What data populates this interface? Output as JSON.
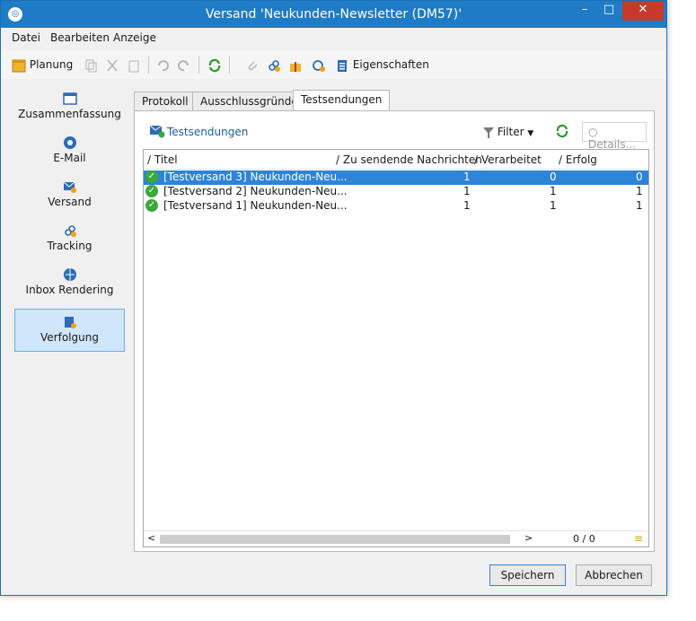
{
  "window": {
    "title": "Versand 'Neukunden-Newsletter (DM57)'",
    "minimize": "–",
    "maximize": "□",
    "close": "✕"
  },
  "menu": [
    "Datei",
    "Bearbeiten",
    "Anzeige"
  ],
  "toolbar": {
    "planung": "Planung",
    "eigenschaften": "Eigenschaften"
  },
  "nav": [
    {
      "label": "Zusammenfassung",
      "icon": "summary-icon"
    },
    {
      "label": "E-Mail",
      "icon": "email-icon"
    },
    {
      "label": "Versand",
      "icon": "delivery-icon"
    },
    {
      "label": "Tracking",
      "icon": "link-icon"
    },
    {
      "label": "Inbox Rendering",
      "icon": "globe-icon"
    },
    {
      "label": "Verfolgung",
      "icon": "tracking-icon",
      "selected": true
    }
  ],
  "tabs": [
    "Protokoll",
    "Ausschlussgründe",
    "Testsendungen"
  ],
  "subbar": {
    "title": "Testsendungen",
    "filter": "Filter",
    "details": "Details..."
  },
  "columns": [
    "Titel",
    "Zu sendende Nachrichten",
    "Verarbeitet",
    "Erfolg"
  ],
  "rows": [
    {
      "titel": "[Testversand 3] Neukunden-Neu...",
      "zu_senden": "1",
      "verarbeitet": "0",
      "erfolg": "0",
      "selected": true
    },
    {
      "titel": "[Testversand 2] Neukunden-Neu...",
      "zu_senden": "1",
      "verarbeitet": "1",
      "erfolg": "1"
    },
    {
      "titel": "[Testversand 1] Neukunden-Neu...",
      "zu_senden": "1",
      "verarbeitet": "1",
      "erfolg": "1"
    }
  ],
  "pager": "0 / 0",
  "buttons": {
    "save": "Speichern",
    "cancel": "Abbrechen"
  },
  "colors": {
    "titlebar": "#1e7bc6",
    "selection": "#2e84d6",
    "close": "#c7392b"
  }
}
